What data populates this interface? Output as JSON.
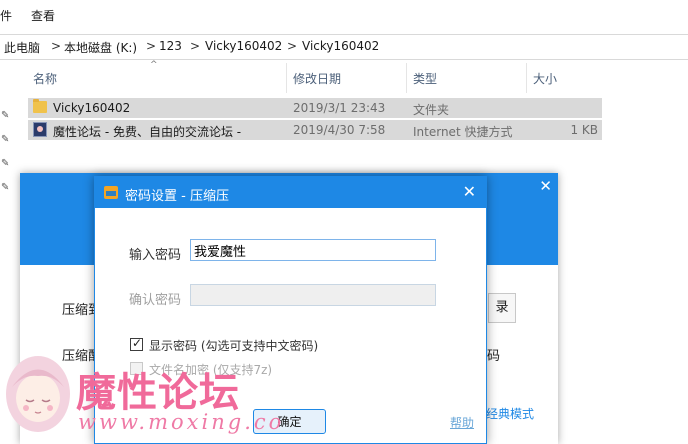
{
  "ribbon": {
    "tab_file": "件",
    "tab_view": "查看"
  },
  "address": {
    "crumbs": [
      "此电脑",
      "本地磁盘 (K:)",
      "123",
      "Vicky160402",
      "Vicky160402"
    ],
    "separator": ">"
  },
  "file_list": {
    "columns": {
      "name": "名称",
      "modified": "修改日期",
      "type": "类型",
      "size": "大小"
    },
    "rows": [
      {
        "icon": "folder-icon",
        "name": "Vicky160402",
        "modified": "2019/3/1 23:43",
        "type": "文件夹",
        "size": ""
      },
      {
        "icon": "internet-shortcut-icon",
        "name": "魔性论坛 - 免费、自由的交流论坛 -",
        "modified": "2019/4/30 7:58",
        "type": "Internet 快捷方式",
        "size": "1 KB"
      }
    ]
  },
  "back_dialog": {
    "close_glyph": "✕",
    "label_1": "压缩到",
    "label_2": "压缩配",
    "browse_button": "录",
    "side_text": "码",
    "classic_mode_link": "经典模式"
  },
  "password_dialog": {
    "title": "密码设置 - 压缩压",
    "close_glyph": "✕",
    "password_label": "输入密码",
    "password_value": "我爱魔性",
    "confirm_label": "确认密码",
    "confirm_value": "",
    "show_password_label": "显示密码 (勾选可支持中文密码)",
    "show_password_checked": true,
    "encrypt_names_label": "文件名加密 (仅支持7z)",
    "encrypt_names_checked": false,
    "ok_button": "确定",
    "help_link": "帮助",
    "accent_color": "#1e88e5"
  },
  "watermark": {
    "title": "魔性论坛",
    "url": "www.moxing.co"
  }
}
